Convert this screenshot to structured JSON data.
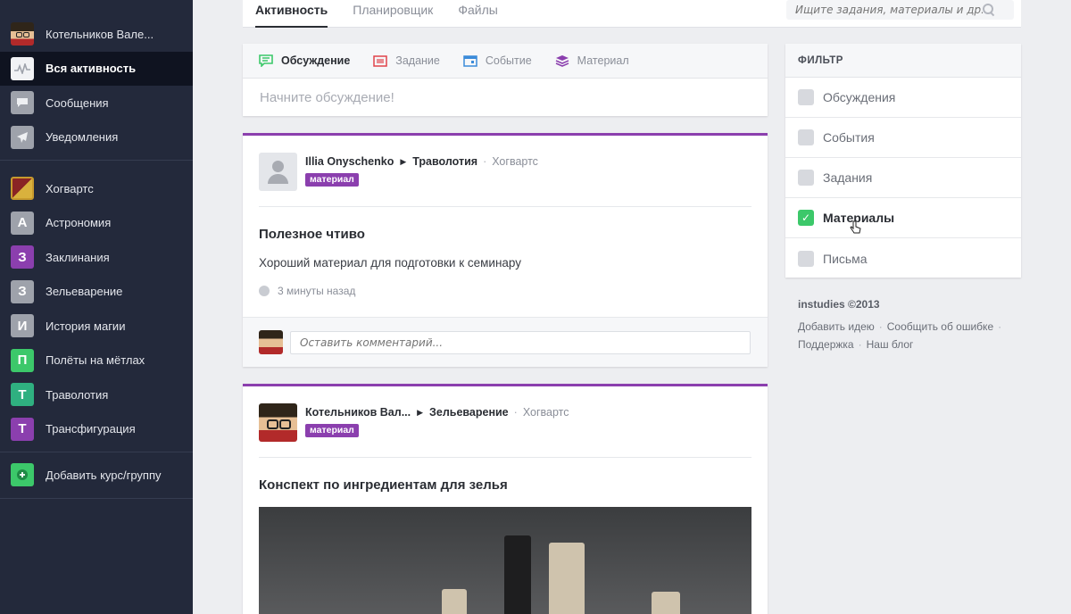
{
  "sidebar": {
    "user": {
      "name": "Котельников Вале..."
    },
    "items": [
      {
        "label": "Вся активность",
        "icon": "activity-icon"
      },
      {
        "label": "Сообщения",
        "icon": "message-icon"
      },
      {
        "label": "Уведомления",
        "icon": "paper-plane-icon"
      }
    ],
    "groups": [
      {
        "label": "Хогвартс",
        "icon": "crest-icon"
      },
      {
        "label": "Астрономия",
        "letter": "А",
        "color": "#9ea2ab"
      },
      {
        "label": "Заклинания",
        "letter": "З",
        "color": "#8b3fae"
      },
      {
        "label": "Зельеварение",
        "letter": "З",
        "color": "#9ea2ab"
      },
      {
        "label": "История магии",
        "letter": "И",
        "color": "#9ea2ab"
      },
      {
        "label": "Полёты на мётлах",
        "letter": "П",
        "color": "#3cc86a"
      },
      {
        "label": "Траволотия",
        "letter": "Т",
        "color": "#2fb080"
      },
      {
        "label": "Трансфигурация",
        "letter": "Т",
        "color": "#8b3fae"
      }
    ],
    "add_course": {
      "label": "Добавить курс/группу",
      "icon": "plus-circle-icon",
      "color": "#3cc86a"
    }
  },
  "topbar": {
    "tabs": [
      "Активность",
      "Планировщик",
      "Файлы"
    ],
    "search_placeholder": "Ищите задания, материалы и др."
  },
  "composer": {
    "tabs": [
      {
        "label": "Обсуждение",
        "icon": "chat-icon",
        "color": "#3cc86a"
      },
      {
        "label": "Задание",
        "icon": "task-icon",
        "color": "#e0434b"
      },
      {
        "label": "Событие",
        "icon": "calendar-icon",
        "color": "#3b8bd9"
      },
      {
        "label": "Материал",
        "icon": "stack-icon",
        "color": "#8b3fae"
      }
    ],
    "placeholder": "Начните обсуждение!"
  },
  "posts": [
    {
      "author": "Illia Onyschenko",
      "course": "Траволотия",
      "group": "Хогвартс",
      "badge": "материал",
      "title": "Полезное чтиво",
      "text": "Хороший материал для подготовки к семинару",
      "time": "3 минуты назад",
      "comment_placeholder": "Оставить комментарий..."
    },
    {
      "author": "Котельников Вал...",
      "course": "Зельеварение",
      "group": "Хогвартс",
      "badge": "материал",
      "title": "Конспект по ингредиентам для зелья"
    }
  ],
  "filter": {
    "title": "ФИЛЬТР",
    "items": [
      {
        "label": "Обсуждения",
        "checked": false
      },
      {
        "label": "События",
        "checked": false
      },
      {
        "label": "Задания",
        "checked": false
      },
      {
        "label": "Материалы",
        "checked": true
      },
      {
        "label": "Письма",
        "checked": false
      }
    ]
  },
  "footer": {
    "copyright": "instudies ©2013",
    "links": [
      "Добавить идею",
      "Сообщить об ошибке",
      "Поддержка",
      "Наш блог"
    ]
  },
  "colors": {
    "sidebar": "#23293b",
    "accent_purple": "#8b3fae",
    "accent_green": "#3cc86a"
  }
}
